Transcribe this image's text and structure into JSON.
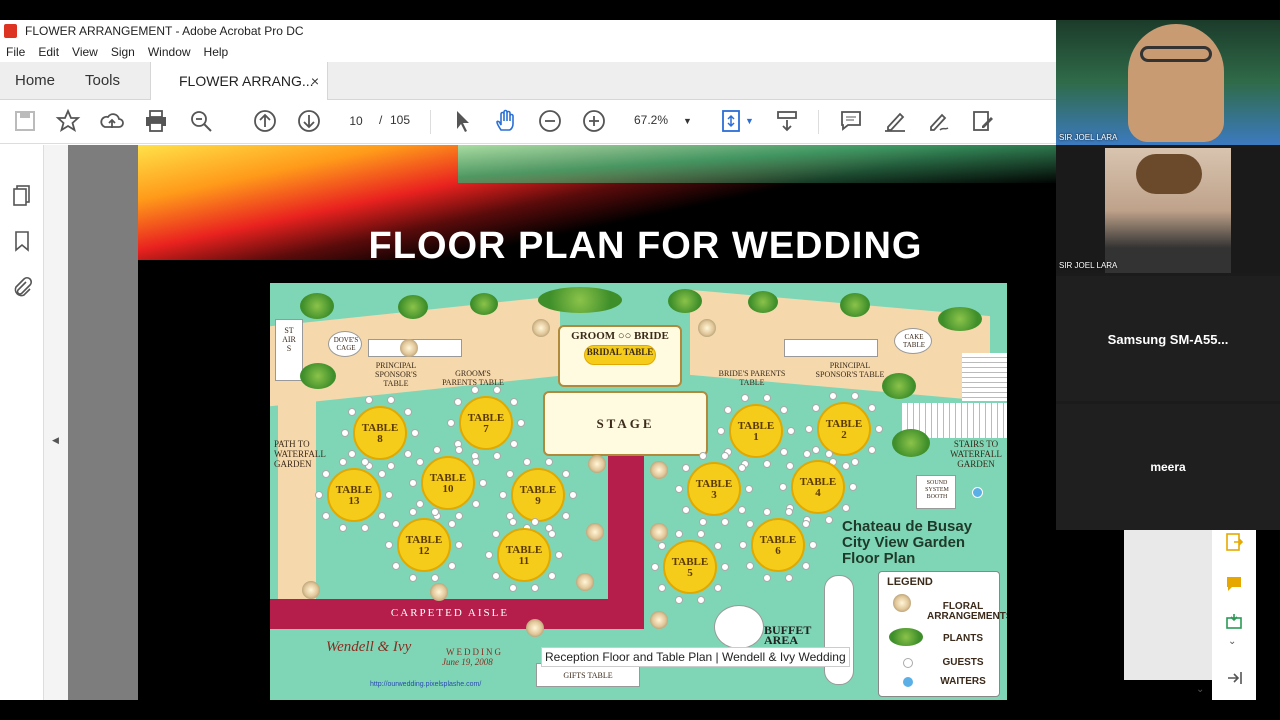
{
  "window": {
    "title": "FLOWER ARRANGEMENT - Adobe Acrobat Pro DC"
  },
  "menu": [
    "File",
    "Edit",
    "View",
    "Sign",
    "Window",
    "Help"
  ],
  "tabs": {
    "home": "Home",
    "tools": "Tools",
    "document": "FLOWER ARRANG...",
    "close": "×"
  },
  "toolbar": {
    "page_current": "10",
    "page_sep": "/",
    "page_total": "105",
    "zoom": "67.2%"
  },
  "slide": {
    "title": "FLOOR PLAN FOR WEDDING",
    "venue_line1": "Chateau de Busay",
    "venue_line2": "City View Garden",
    "venue_line3": "Floor Plan",
    "stage": "STAGE",
    "groom": "GROOM",
    "bride": "BRIDE",
    "bridal_table": "BRIDAL TABLE",
    "doves_cage": "DOVE'S CAGE",
    "cake_table": "CAKE TABLE",
    "principal_sponsors_left": "PRINCIPAL SPONSOR'S TABLE",
    "principal_sponsors_right": "PRINCIPAL SPONSOR'S TABLE",
    "grooms_parents": "GROOM'S PARENTS TABLE",
    "brides_parents": "BRIDE'S PARENTS TABLE",
    "stairs": "STAIRS",
    "path": "PATH TO WATERFALL GARDEN",
    "stairs_waterfall": "STAIRS TO WATERFALL GARDEN",
    "sound_booth": "SOUND SYSTEM BOOTH",
    "aisle": "CARPETED AISLE",
    "buffet": "BUFFET AREA",
    "gifts": "GIFTS TABLE",
    "couple": "Wendell & Ivy",
    "wedding": "WEDDING",
    "date": "June 19, 2008",
    "url": "http://ourwedding.pixelsplashe.com/",
    "legend_title": "LEGEND",
    "legend_floral": "FLORAL ARRANGEMENTS",
    "legend_plants": "PLANTS",
    "legend_guests": "GUESTS",
    "legend_waiters": "WAITERS",
    "table_word": "TABLE",
    "tables": [
      "1",
      "2",
      "3",
      "4",
      "5",
      "6",
      "7",
      "8",
      "9",
      "10",
      "11",
      "12",
      "13"
    ]
  },
  "caption": "Reception Floor and Table Plan | Wendell & Ivy Wedding",
  "participants": [
    {
      "name": "SIR JOEL LARA"
    },
    {
      "name": "SIR JOEL LARA"
    },
    {
      "name": "Samsung  SM-A55..."
    },
    {
      "name": "meera"
    }
  ],
  "icons": {
    "left_rail": [
      "pages-icon",
      "bookmark-icon",
      "attachment-icon"
    ]
  }
}
